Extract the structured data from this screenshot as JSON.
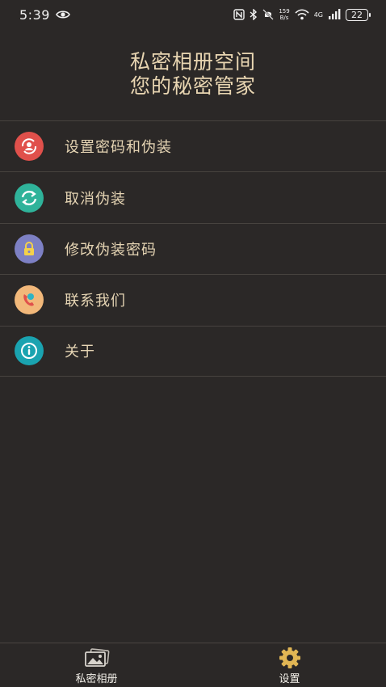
{
  "status_bar": {
    "time": "5:39",
    "speed_value": "159",
    "speed_unit": "B/s",
    "network": "4G",
    "battery": "22"
  },
  "header": {
    "title_line1": "私密相册空间",
    "title_line2": "您的秘密管家"
  },
  "menu": {
    "items": [
      {
        "label": "设置密码和伪装",
        "icon": "user-sync-icon",
        "color": "#e0504b"
      },
      {
        "label": "取消伪装",
        "icon": "refresh-icon",
        "color": "#2fb39a"
      },
      {
        "label": "修改伪装密码",
        "icon": "lock-icon",
        "color": "#7d80c4"
      },
      {
        "label": "联系我们",
        "icon": "phone-icon",
        "color": "#f2b87a"
      },
      {
        "label": "关于",
        "icon": "info-icon",
        "color": "#1aa3b0"
      }
    ]
  },
  "tabbar": {
    "tabs": [
      {
        "label": "私密相册",
        "icon": "photos-icon"
      },
      {
        "label": "设置",
        "icon": "gear-icon"
      }
    ],
    "active_color": "#e1b654"
  }
}
